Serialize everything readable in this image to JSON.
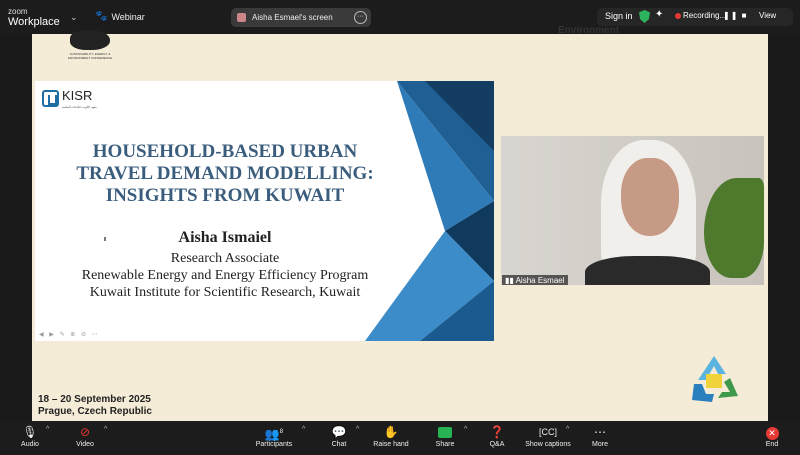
{
  "topbar": {
    "logo_small": "zoom",
    "logo_big": "Workplace",
    "webinar_label": "Webinar",
    "screen_label": "Aisha Esmael's screen",
    "signin": "Sign in",
    "recording": "Recording...",
    "view": "View"
  },
  "conference": {
    "logo_text": "SUSTAINABILITY, ENERGY & ENVIRONMENT CONFERENCE",
    "top_label": "Environment",
    "dates": "18 – 20 September 2025",
    "location": "Prague, Czech Republic"
  },
  "slide": {
    "org": "KISR",
    "org_sub": "معهد الكويت للأبحاث العلمية",
    "title_lines": [
      "HOUSEHOLD-BASED URBAN",
      "TRAVEL DEMAND MODELLING:",
      "INSIGHTS FROM KUWAIT"
    ],
    "presenter": "Aisha Ismaiel",
    "role": "Research Associate",
    "program": "Renewable Energy and Energy Efficiency Program",
    "institute": "Kuwait Institute for Scientific Research, Kuwait"
  },
  "video": {
    "name": "Aisha Esmael"
  },
  "controls": {
    "audio": "Audio",
    "video": "Video",
    "participants": "Participants",
    "participants_count": "8",
    "chat": "Chat",
    "raise_hand": "Raise hand",
    "share": "Share",
    "qa": "Q&A",
    "captions": "Show captions",
    "more": "More",
    "end": "End"
  }
}
